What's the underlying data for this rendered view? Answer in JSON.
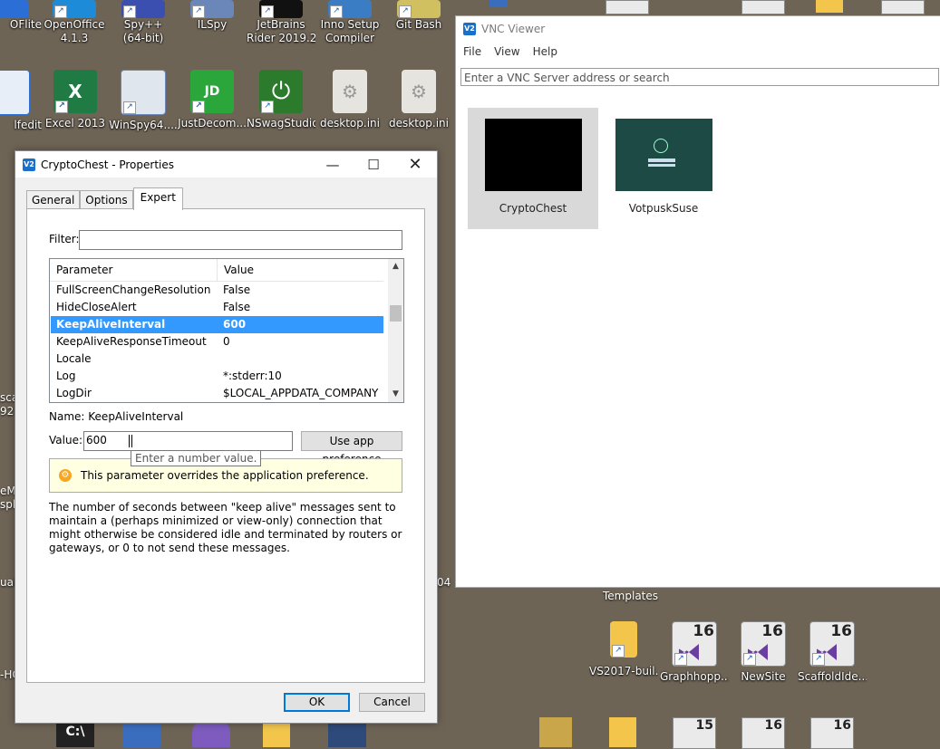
{
  "desktop": {
    "icons_top": [
      {
        "label": "OFlite",
        "name": "pdf-app-icon"
      },
      {
        "label": "OpenOffice\n4.1.3",
        "name": "openoffice-icon"
      },
      {
        "label": "Spy++\n(64-bit)",
        "name": "spy-icon"
      },
      {
        "label": "ILSpy",
        "name": "ilspy-icon"
      },
      {
        "label": "JetBrains\nRider 2019.2...",
        "name": "rider-icon"
      },
      {
        "label": "Inno Setup\nCompiler",
        "name": "innosetup-icon"
      },
      {
        "label": "Git Bash",
        "name": "git-bash-icon"
      }
    ],
    "icons_row2": [
      {
        "label": "lfedit",
        "name": "edit-app-icon"
      },
      {
        "label": "Excel 2013",
        "name": "excel-icon"
      },
      {
        "label": "WinSpy64....",
        "name": "winspy-icon"
      },
      {
        "label": "JustDecom...",
        "name": "justdecompile-icon"
      },
      {
        "label": "NSwagStudio",
        "name": "nswag-icon"
      },
      {
        "label": "desktop.ini",
        "name": "file-icon"
      },
      {
        "label": "desktop.ini",
        "name": "file-icon"
      }
    ],
    "bottom_icons": [
      {
        "label": "VS2017-buil...",
        "kind": "folder"
      },
      {
        "label": "Graphhopp...",
        "kind": "vs",
        "num": "16"
      },
      {
        "label": "NewSite",
        "kind": "vs",
        "num": "16"
      },
      {
        "label": "ScaffoldIde...",
        "kind": "vs",
        "num": "16"
      }
    ],
    "templates_label": "Templates",
    "fragments": [
      "sca",
      "92.",
      "eM",
      "spla",
      "ualD",
      "-HC",
      "04"
    ]
  },
  "vnc": {
    "title": "VNC Viewer",
    "logo": "V2",
    "menu": [
      "File",
      "View",
      "Help"
    ],
    "search_placeholder": "Enter a VNC Server address or search",
    "connections": [
      {
        "name": "CryptoChest",
        "selected": true
      },
      {
        "name": "VotpuskSuse",
        "selected": false
      }
    ]
  },
  "dialog": {
    "title": "CryptoChest - Properties",
    "logo": "V2",
    "tabs": [
      {
        "label": "General",
        "active": false
      },
      {
        "label": "Options",
        "active": false
      },
      {
        "label": "Expert",
        "active": true
      }
    ],
    "filter_label": "Filter:",
    "filter_value": "",
    "columns": {
      "parameter": "Parameter",
      "value": "Value"
    },
    "rows": [
      {
        "param": "FullScreenChangeResolution",
        "value": "False",
        "selected": false
      },
      {
        "param": "HideCloseAlert",
        "value": "False",
        "selected": false
      },
      {
        "param": "KeepAliveInterval",
        "value": "600",
        "selected": true
      },
      {
        "param": "KeepAliveResponseTimeout",
        "value": "0",
        "selected": false
      },
      {
        "param": "Locale",
        "value": "",
        "selected": false
      },
      {
        "param": "Log",
        "value": "*:stderr:10",
        "selected": false
      },
      {
        "param": "LogDir",
        "value": "$LOCAL_APPDATA_COMPANY",
        "selected": false
      }
    ],
    "name_label": "Name:",
    "name_value": "KeepAliveInterval",
    "value_label": "Value:",
    "value_input": "600",
    "use_app_pref": "Use app preference",
    "tooltip": "Enter a number value.",
    "info": "This parameter overrides the application preference.",
    "description": "The number of seconds between \"keep alive\" messages sent to maintain a (perhaps minimized or view-only) connection that might otherwise be considered idle and terminated by routers or gateways, or 0 to not send these messages.",
    "ok": "OK",
    "cancel": "Cancel"
  }
}
